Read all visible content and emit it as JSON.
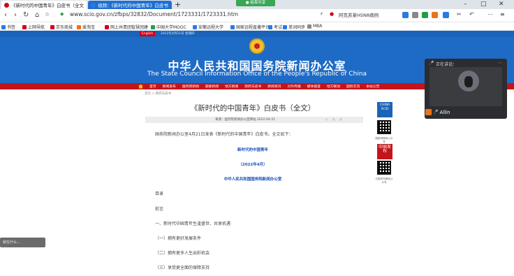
{
  "browser": {
    "tabs": [
      {
        "label": "《新时代的中国青年》白皮书（全文",
        "close": "×"
      },
      {
        "label": "视频：《新时代的中国青年》白皮书",
        "close": "×"
      }
    ],
    "new_tab": "+",
    "sharing_badge": "● 结束共享",
    "url": "www.scio.gov.cn/zfbps/32832/Document/1723331/1723331.htm",
    "search_text": "阿克苏某HSN8病例",
    "window_controls": [
      "–",
      "□",
      "✕"
    ]
  },
  "bookmarks": [
    {
      "label": "书签",
      "color": "#2b79e3"
    },
    {
      "label": "上网导航",
      "color": "#d0021b"
    },
    {
      "label": "京东商城",
      "color": "#d0021b"
    },
    {
      "label": "爱淘宝",
      "color": "#ff6a00"
    },
    {
      "label": "网上共青团智慧团建",
      "color": "#d0021b"
    },
    {
      "label": "中国大学MOOC",
      "color": "#1f9e4a"
    },
    {
      "label": "安徽远程大学",
      "color": "#2b79e3"
    },
    {
      "label": "国家远程直播平台",
      "color": "#2b79e3"
    },
    {
      "label": "考试",
      "color": "#2b79e3"
    },
    {
      "label": "单词同步",
      "color": "#2b79e3"
    },
    {
      "label": "MBA",
      "color": "#888888"
    }
  ],
  "site": {
    "english_btn": "English",
    "date": "2022年4月21日 星期四",
    "title_cn": "中华人民共和国国务院新闻办公室",
    "title_en": "The State Council Information Office of the People's Republic of China",
    "menu": [
      "首页",
      "新闻发布",
      "国务院新闻",
      "部委新闻",
      "地方新闻",
      "政府白皮书",
      "新闻资讯",
      "对外传播",
      "媒体报道",
      "地方联动",
      "国际交流",
      "本站公告"
    ],
    "breadcrumb": "首页 > 政府白皮书"
  },
  "article": {
    "title": "《新时代的中国青年》白皮书（全文）",
    "meta": "来源：国务院新闻办公室网站  2022-04-21",
    "actions": "< A A",
    "intro": "国务院新闻办公室4月21日发表《新时代的中国青年》白皮书。全文如下：",
    "heading1": "新时代的中国青年",
    "heading2": "（2022年4月）",
    "heading3": "中华人民共和国国务院新闻办公室",
    "toc_label": "目录",
    "preface": "前言",
    "section1": "一、新时代中国青年生逢盛世、共享机遇",
    "sub1": "（一）拥有更好发展条件",
    "sub2": "（二）拥有更多人生出彩机会",
    "sub3": "（三）享受更全面的保障支持"
  },
  "sidebar": {
    "logo1": "CHINA SCIO",
    "qr_caption1": "国新网微信公众号",
    "logo2": "中国发布",
    "qr_caption2": "中国发布微信公众号"
  },
  "video": {
    "speaker": "正在讲话：",
    "participant": "Allin"
  },
  "toast": "就在什么..."
}
